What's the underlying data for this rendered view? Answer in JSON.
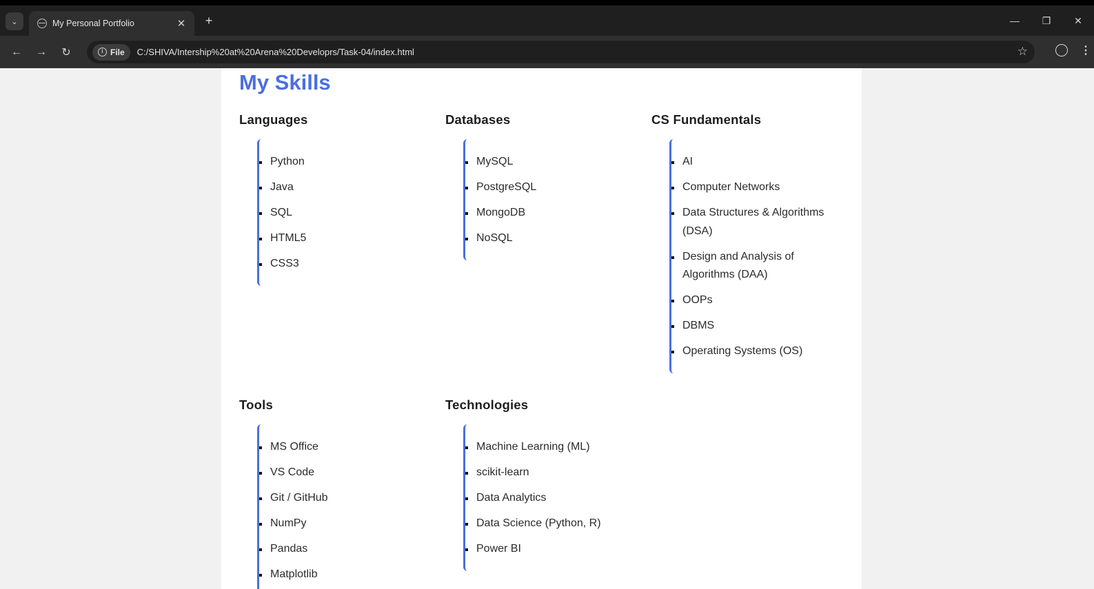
{
  "browser": {
    "tab_title": "My Personal Portfolio",
    "tab_close": "✕",
    "new_tab": "+",
    "chip_label": "File",
    "url": "C:/SHIVA/Intership%20at%20Arena%20Developrs/Task-04/index.html",
    "window": {
      "minimize": "—",
      "restore": "❐",
      "close": "✕"
    },
    "nav": {
      "back": "←",
      "forward": "→",
      "reload": "↻"
    }
  },
  "page": {
    "heading": "My Skills",
    "groups": {
      "languages": {
        "title": "Languages",
        "items": [
          "Python",
          "Java",
          "SQL",
          "HTML5",
          "CSS3"
        ]
      },
      "databases": {
        "title": "Databases",
        "items": [
          "MySQL",
          "PostgreSQL",
          "MongoDB",
          "NoSQL"
        ]
      },
      "cs": {
        "title": "CS Fundamentals",
        "items": [
          "AI",
          "Computer Networks",
          "Data Structures & Algorithms (DSA)",
          "Design and Analysis of Algorithms (DAA)",
          "OOPs",
          "DBMS",
          "Operating Systems (OS)"
        ]
      },
      "tools": {
        "title": "Tools",
        "items": [
          "MS Office",
          "VS Code",
          "Git / GitHub",
          "NumPy",
          "Pandas",
          "Matplotlib"
        ]
      },
      "technologies": {
        "title": "Technologies",
        "items": [
          "Machine Learning (ML)",
          "scikit-learn",
          "Data Analytics",
          "Data Science (Python, R)",
          "Power BI"
        ]
      }
    }
  },
  "colors": {
    "accent": "#4c6ee0",
    "card_bg": "#ffffff",
    "page_bg": "#f1f1f1",
    "chrome_dark": "#1f1f1f"
  }
}
